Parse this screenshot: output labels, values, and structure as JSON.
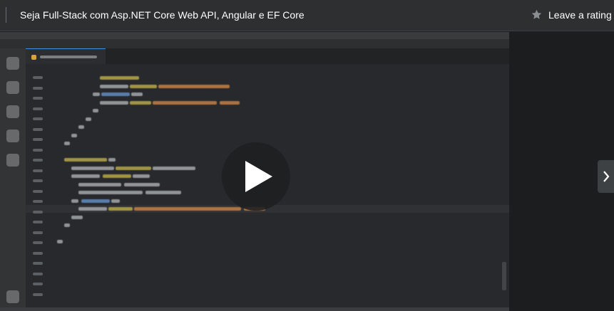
{
  "header": {
    "course_title": "Seja Full-Stack com Asp.NET Core Web API, Angular e EF Core",
    "rating_label": "Leave a rating"
  },
  "video": {
    "state": "paused"
  },
  "icons": {
    "star": "star-icon",
    "play": "play-icon",
    "next": "chevron-right-icon"
  },
  "colors": {
    "header_bg": "#2d2f31",
    "page_bg": "#1c1d1f",
    "editor_bg": "#27292c",
    "code_yellow": "#c9b84c",
    "code_orange": "#d98a45",
    "code_blue": "#6a9ad6",
    "code_plain": "#b5b8bb"
  }
}
